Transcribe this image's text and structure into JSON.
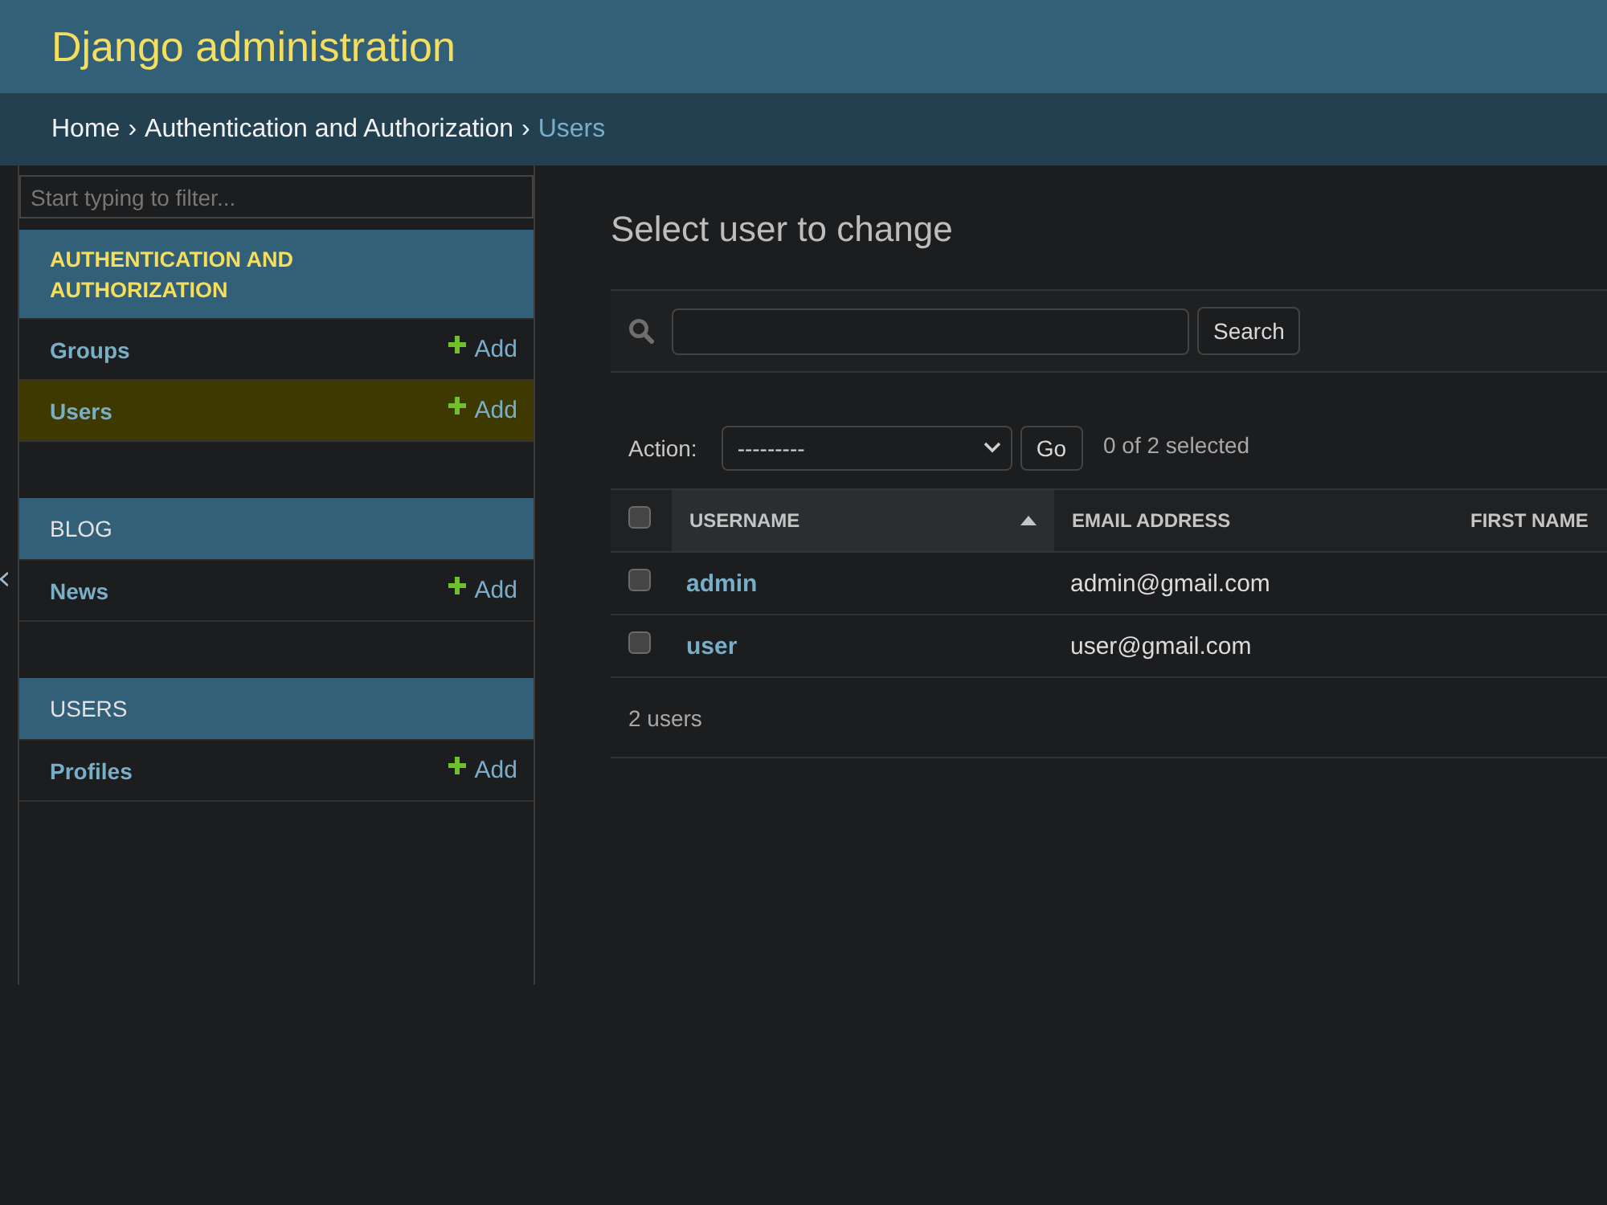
{
  "header": {
    "title": "Django administration"
  },
  "breadcrumbs": [
    {
      "kind": "link",
      "label": "Home"
    },
    {
      "kind": "separator",
      "label": "›"
    },
    {
      "kind": "link",
      "label": "Authentication and Authorization"
    },
    {
      "kind": "separator",
      "label": "›"
    },
    {
      "kind": "current",
      "label": "Users"
    }
  ],
  "sidebar": {
    "filter": {
      "placeholder": "Start typing to filter..."
    },
    "apps": [
      {
        "name": "AUTHENTICATION AND AUTHORIZATION",
        "selected": true,
        "models": [
          {
            "name": "Groups",
            "selected": false,
            "add": "Add"
          },
          {
            "name": "Users",
            "selected": true,
            "add": "Add"
          }
        ]
      },
      {
        "name": "BLOG",
        "selected": false,
        "models": [
          {
            "name": "News",
            "selected": false,
            "add": "Add"
          }
        ]
      },
      {
        "name": "USERS",
        "selected": false,
        "models": [
          {
            "name": "Profiles",
            "selected": false,
            "add": "Add"
          }
        ]
      }
    ]
  },
  "content": {
    "title": "Select user to change",
    "search": {
      "button": "Search"
    },
    "actions": {
      "label": "Action:",
      "value": "---------",
      "button": "Go",
      "counter": "0 of 2 selected"
    },
    "table": {
      "select_all": {
        "checked": false
      },
      "columns": [
        {
          "label": "USERNAME",
          "sorted": true
        },
        {
          "label": "EMAIL ADDRESS",
          "sorted": false
        },
        {
          "label": "FIRST NAME",
          "sorted": false
        }
      ],
      "rows": [
        {
          "checked": false,
          "cells": [
            "admin",
            "admin@gmail.com"
          ]
        },
        {
          "checked": false,
          "cells": [
            "user",
            "user@gmail.com"
          ]
        }
      ],
      "footer": "2 users"
    }
  }
}
